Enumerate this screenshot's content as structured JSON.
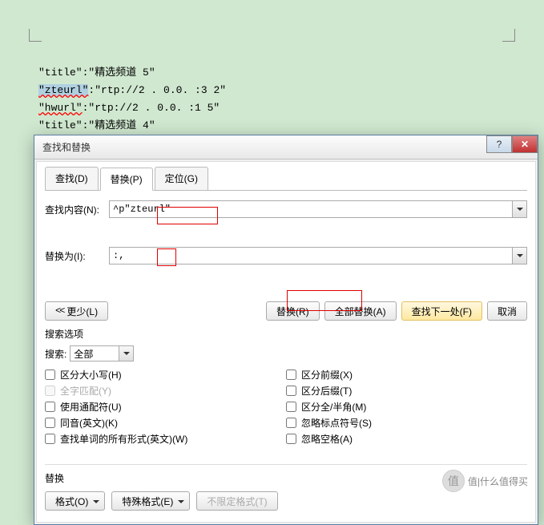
{
  "background_lines": [
    {
      "pre": "\"title\":\"精选频道 5\"",
      "hl": " "
    },
    {
      "hl_pre": "\"zteurl\"",
      "text": ":\"rtp://2  .  0.0.  :3  2\""
    },
    {
      "err": "\"hwurl\"",
      "text": ":\"rtp://2  .  0.0.   :1  5\""
    },
    {
      "pre": "\"title\":\"精选频道 4\""
    }
  ],
  "dialog": {
    "title": "查找和替换",
    "tabs": {
      "find": "查找(D)",
      "replace": "替换(P)",
      "goto": "定位(G)"
    },
    "find_label": "查找内容(N):",
    "find_value": "^p\"zteurl\"",
    "replace_label": "替换为(I):",
    "replace_value": ":,",
    "buttons": {
      "more": "更少(L)",
      "replace_one": "替换(R)",
      "replace_all": "全部替换(A)",
      "find_next": "查找下一处(F)",
      "cancel": "取消"
    },
    "options_title": "搜索选项",
    "search_label": "搜索:",
    "search_value": "全部",
    "checks_left": [
      {
        "label": "区分大小写(H)",
        "dis": false
      },
      {
        "label": "全字匹配(Y)",
        "dis": true
      },
      {
        "label": "使用通配符(U)",
        "dis": false
      },
      {
        "label": "同音(英文)(K)",
        "dis": false
      },
      {
        "label": "查找单词的所有形式(英文)(W)",
        "dis": false
      }
    ],
    "checks_right": [
      {
        "label": "区分前缀(X)"
      },
      {
        "label": "区分后缀(T)"
      },
      {
        "label": "区分全/半角(M)"
      },
      {
        "label": "忽略标点符号(S)"
      },
      {
        "label": "忽略空格(A)"
      }
    ],
    "bottom": {
      "section": "替换",
      "format": "格式(O)",
      "special": "特殊格式(E)",
      "noformat": "不限定格式(T)"
    }
  },
  "watermark": "值|什么值得买"
}
